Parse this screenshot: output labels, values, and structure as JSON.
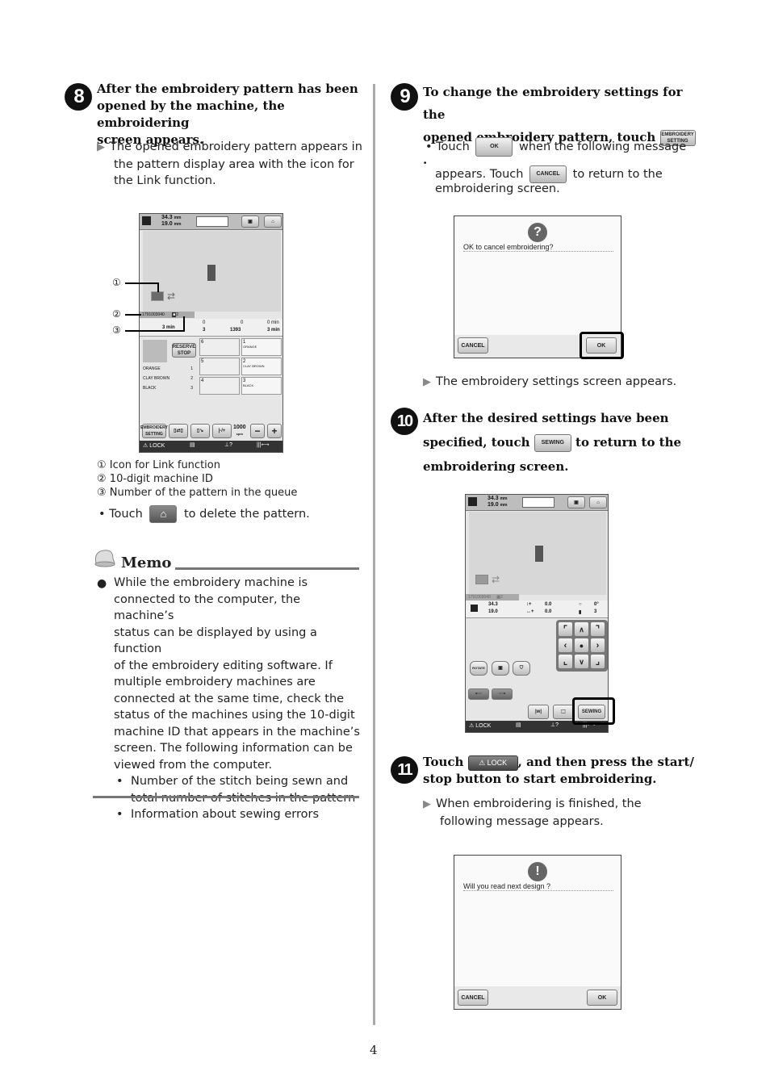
{
  "page_number": "4",
  "steps": [
    {
      "number": "8",
      "heading": "After the embroidery pattern has been opened by the machine, the embroidering screen appears.",
      "heading_lines": [
        "After the embroidery pattern has been",
        "opened by the machine, the embroidering",
        "screen appears."
      ],
      "result_lines": [
        "The opened embroidery pattern appears in",
        "the pattern display area with the icon for",
        "the Link function."
      ],
      "legend": [
        {
          "marker": "①",
          "text": "Icon for Link function"
        },
        {
          "marker": "②",
          "text": "10-digit machine ID"
        },
        {
          "marker": "③",
          "text": "Number of the pattern in the queue"
        }
      ],
      "bullet": {
        "before": "• Touch",
        "after": "to delete the pattern.",
        "icon": "home-icon"
      }
    },
    {
      "number": "9",
      "heading_lines": [
        "To change the embroidery settings for the",
        "opened embroidery pattern, touch"
      ],
      "heading_button": {
        "line1": "EMBROIDERY",
        "line2": "SETTING"
      },
      "bullet": {
        "touch": "• Touch",
        "ok_label": "OK",
        "after_ok": "when the following message",
        "appears": "appears. Touch",
        "cancel_label": "CANCEL",
        "after_cancel": "to return to the",
        "last": "embroidering screen."
      },
      "result": "The embroidery settings screen appears."
    },
    {
      "number": "10",
      "heading_lines": [
        "After the desired settings have been",
        "specified, touch",
        "to return to the",
        "embroidering screen."
      ],
      "button_label": "SEWING"
    },
    {
      "number": "11",
      "heading_lines": [
        "Touch",
        ", and then press the start/",
        "stop button to start embroidering."
      ],
      "lock_label": "LOCK",
      "result_lines": [
        "When embroidering is finished, the",
        "following message appears."
      ]
    }
  ],
  "memo": {
    "title": "Memo",
    "lines": [
      "While the embroidery machine is",
      "connected to the computer, the machine’s",
      "status can be displayed by using a function",
      "of the embroidery editing software. If",
      "multiple embroidery machines are",
      "connected at the same time, check the",
      "status of the machines using the 10-digit",
      "machine ID that appears in the machine’s",
      "screen. The following information can be",
      "viewed from the computer."
    ],
    "subitems": [
      [
        "Number of the stitch being sewn and",
        "total number of stitches in the pattern"
      ],
      [
        "Information about sewing errors"
      ]
    ]
  },
  "screen1": {
    "height_mm": "34.3",
    "width_mm": "19.0",
    "unit": "mm",
    "machine_id": "1791003040",
    "queue_number": "2",
    "time_label": "3 min",
    "color_count_top": "0",
    "color_count_bottom": "3",
    "stitch_top": "0",
    "stitch_bottom": "1393",
    "time_top": "0 min",
    "time_bottom": "3 min",
    "reserve_stop": [
      "RESERVE",
      "STOP"
    ],
    "thread_list": [
      {
        "name": "ORANGE",
        "num": "1"
      },
      {
        "name": "CLAY BROWN",
        "num": "2"
      },
      {
        "name": "BLACK",
        "num": "3"
      }
    ],
    "spools": [
      {
        "num": "6",
        "name": ""
      },
      {
        "num": "1",
        "name": "ORANGE"
      },
      {
        "num": "5",
        "name": ""
      },
      {
        "num": "2",
        "name": "CLAY BROWN"
      },
      {
        "num": "4",
        "name": ""
      },
      {
        "num": "3",
        "name": "BLACK"
      }
    ],
    "embroidery_setting": [
      "EMBROIDERY",
      "SETTING"
    ],
    "speed": "1000",
    "speed_unit": "spm",
    "minus": "−",
    "plus": "+",
    "lock": "LOCK",
    "callouts": [
      "①",
      "②",
      "③"
    ]
  },
  "dialog1": {
    "message": "OK to cancel embroidering?",
    "icon": "?",
    "cancel": "CANCEL",
    "ok": "OK"
  },
  "screen2": {
    "height_mm": "34.3",
    "width_mm": "19.0",
    "unit": "mm",
    "machine_id": "1791003040",
    "queue_number": "2",
    "size_h": "34.3",
    "size_w": "19.0",
    "offset_v": "0.0",
    "offset_h": "0.0",
    "angle": "0°",
    "colors": "3",
    "rotate": "ROTATE",
    "sewing": "SEWING",
    "lock": "LOCK"
  },
  "dialog2": {
    "message": "Will you read next design ?",
    "icon": "!",
    "cancel": "CANCEL",
    "ok": "OK"
  }
}
